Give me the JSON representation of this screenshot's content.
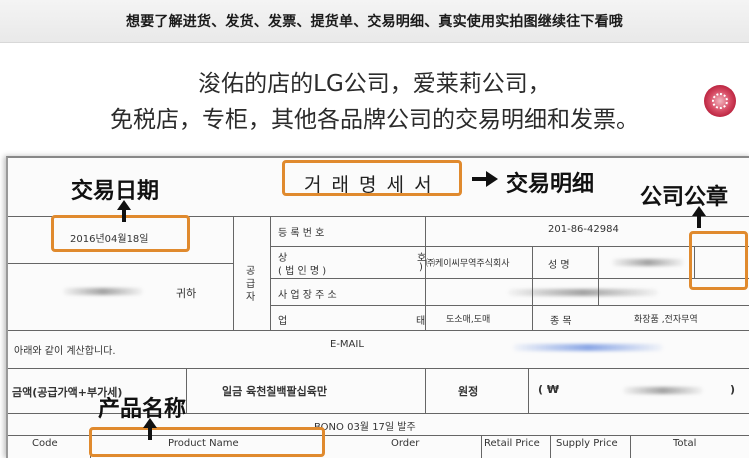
{
  "banner": {
    "text": "想要了解进货、发货、发票、提货单、交易明细、真实使用实拍图继续往下看哦"
  },
  "intro": {
    "line1": "浚佑的店的LG公司，爱莱莉公司，",
    "line2": "免税店，专柜，其他各品牌公司的交易明细和发票。"
  },
  "annotations": {
    "trade_statement": "交易明细",
    "trade_date": "交易日期",
    "company_seal": "公司公章",
    "product_name": "产品名称",
    "highlight_color": "#e08a2e"
  },
  "document": {
    "title": "거 래 명 세 서",
    "date": "2016년04월18일",
    "recipient_suffix": "귀하",
    "note": "아래와 같이 계산합니다.",
    "supplier_label": [
      "공",
      "급",
      "자"
    ],
    "reg_label": "등      록      번      호",
    "reg_number": "201-86-42984",
    "company_label_a": "상",
    "company_label_b": "(   법   인   명   )",
    "company_label_end_a": "호",
    "company_label_end_b": ")",
    "company_name": "㈜케이씨무역주식회사",
    "ceo_label": "성 명",
    "address_label": "사   업   장   주   소",
    "business_label_a": "업",
    "business_label_b": "태",
    "business_type": "도소매,도매",
    "item_label": "종 목",
    "item_type": "화장품 ,전자무역",
    "email_label": "E-MAIL",
    "amount_label": "금액(공급가액+부가세)",
    "amount_korean": "일금  육천칠백팔십육만",
    "won_label": "원정",
    "currency_open": "(    ₩",
    "currency_close": ")",
    "order_ref": "BONO 03월 17일 발주",
    "columns": {
      "code": "Code",
      "product_name": "Product Name",
      "order": "Order",
      "retail_price": "Retail Price",
      "supply_price": "Supply Price",
      "total": "Total"
    }
  }
}
